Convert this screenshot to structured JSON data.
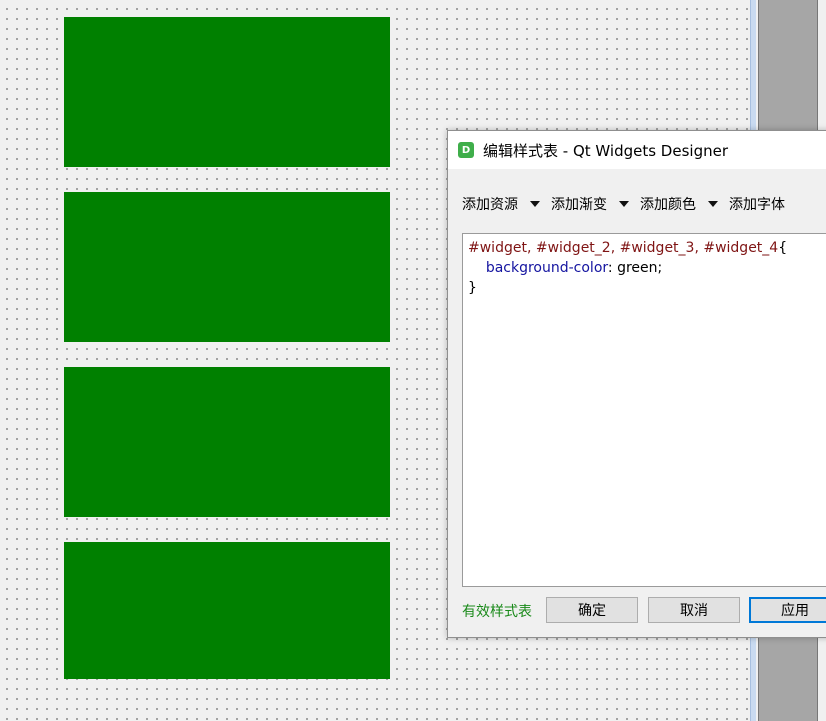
{
  "canvas": {
    "widget_color": "#008000",
    "widgets": [
      {
        "name": "widget"
      },
      {
        "name": "widget_2"
      },
      {
        "name": "widget_3"
      },
      {
        "name": "widget_4"
      }
    ]
  },
  "dialog": {
    "app_icon": "D",
    "app_icon_name": "qt-designer-icon",
    "title": "编辑样式表 - Qt Widgets Designer",
    "toolbar": {
      "add_resource": "添加资源",
      "add_gradient": "添加渐变",
      "add_color": "添加颜色",
      "add_font": "添加字体"
    },
    "editor": {
      "line1_selector": "#widget, #widget_2, #widget_3, #widget_4",
      "line1_brace": "{",
      "line2_indent": "    ",
      "line2_property": "background-color",
      "line2_colon": ": ",
      "line2_value": "green;",
      "line3_brace": "}"
    },
    "status": "有效样式表",
    "buttons": {
      "ok": "确定",
      "cancel": "取消",
      "apply": "应用"
    }
  },
  "colors": {
    "valid_text": "#1a8a1a",
    "selector": "#7f1414",
    "property": "#1414a0",
    "apply_border": "#0078d7"
  }
}
